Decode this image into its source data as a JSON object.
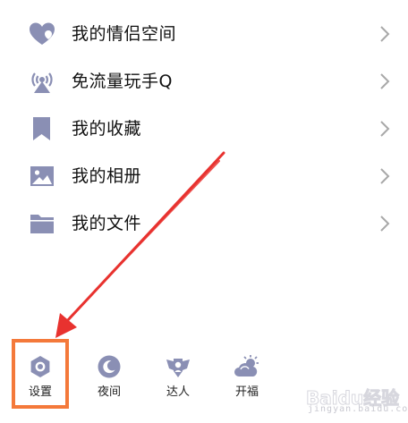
{
  "menu": {
    "items": [
      {
        "label": "我的情侣空间",
        "icon": "heart-couple-icon"
      },
      {
        "label": "免流量玩手Q",
        "icon": "signal-tower-icon"
      },
      {
        "label": "我的收藏",
        "icon": "bookmark-icon"
      },
      {
        "label": "我的相册",
        "icon": "photo-album-icon"
      },
      {
        "label": "我的文件",
        "icon": "folder-icon"
      }
    ]
  },
  "toolbar": {
    "items": [
      {
        "label": "设置",
        "icon": "settings-hexagon-icon"
      },
      {
        "label": "夜间",
        "icon": "moon-icon"
      },
      {
        "label": "达人",
        "icon": "winged-badge-icon"
      },
      {
        "label": "开福",
        "icon": "cloud-sun-icon"
      }
    ]
  },
  "annotation": {
    "highlight_color": "#f4793a",
    "arrow_color": "#e8322f",
    "target": "设置"
  },
  "colors": {
    "icon_fill": "#8a8fb4",
    "text": "#111111",
    "chevron": "#a8a8a8"
  },
  "watermark": {
    "brand": "Baidu经验",
    "sub": "jingyan.baidu.com"
  }
}
